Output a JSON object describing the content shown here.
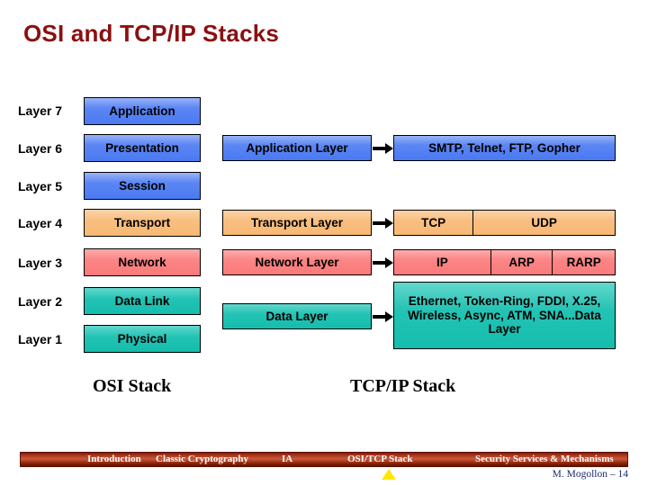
{
  "title": "OSI and TCP/IP Stacks",
  "colors": {
    "title": "#8B1010",
    "blue": "#5b86f4",
    "orange": "#f9bf81",
    "pink": "#fb8585",
    "teal": "#23c3b4",
    "footer_bar": "#a8341a",
    "footer_marker": "#FFE800",
    "footer_author": "#1b2a6b"
  },
  "osi": {
    "caption": "OSI Stack",
    "layers": [
      {
        "label": "Layer 7",
        "name": "Application"
      },
      {
        "label": "Layer 6",
        "name": "Presentation"
      },
      {
        "label": "Layer 5",
        "name": "Session"
      },
      {
        "label": "Layer 4",
        "name": "Transport"
      },
      {
        "label": "Layer 3",
        "name": "Network"
      },
      {
        "label": "Layer 2",
        "name": "Data Link"
      },
      {
        "label": "Layer 1",
        "name": "Physical"
      }
    ]
  },
  "tcpip": {
    "caption": "TCP/IP Stack",
    "layers": [
      {
        "name": "Application Layer"
      },
      {
        "name": "Transport Layer"
      },
      {
        "name": "Network Layer"
      },
      {
        "name": "Data Layer"
      }
    ],
    "protocols": {
      "application": "SMTP, Telnet, FTP, Gopher",
      "transport": [
        "TCP",
        "UDP"
      ],
      "network": [
        "IP",
        "ARP",
        "RARP"
      ],
      "data": "Ethernet, Token-Ring, FDDI, X.25, Wireless, Async, ATM, SNA...Data Layer"
    }
  },
  "footer": {
    "items": [
      "Introduction",
      "Classic Cryptography",
      "IA",
      "OSI/TCP Stack",
      "Security Services & Mechanisms"
    ],
    "author": "M. Mogollon – 14"
  }
}
